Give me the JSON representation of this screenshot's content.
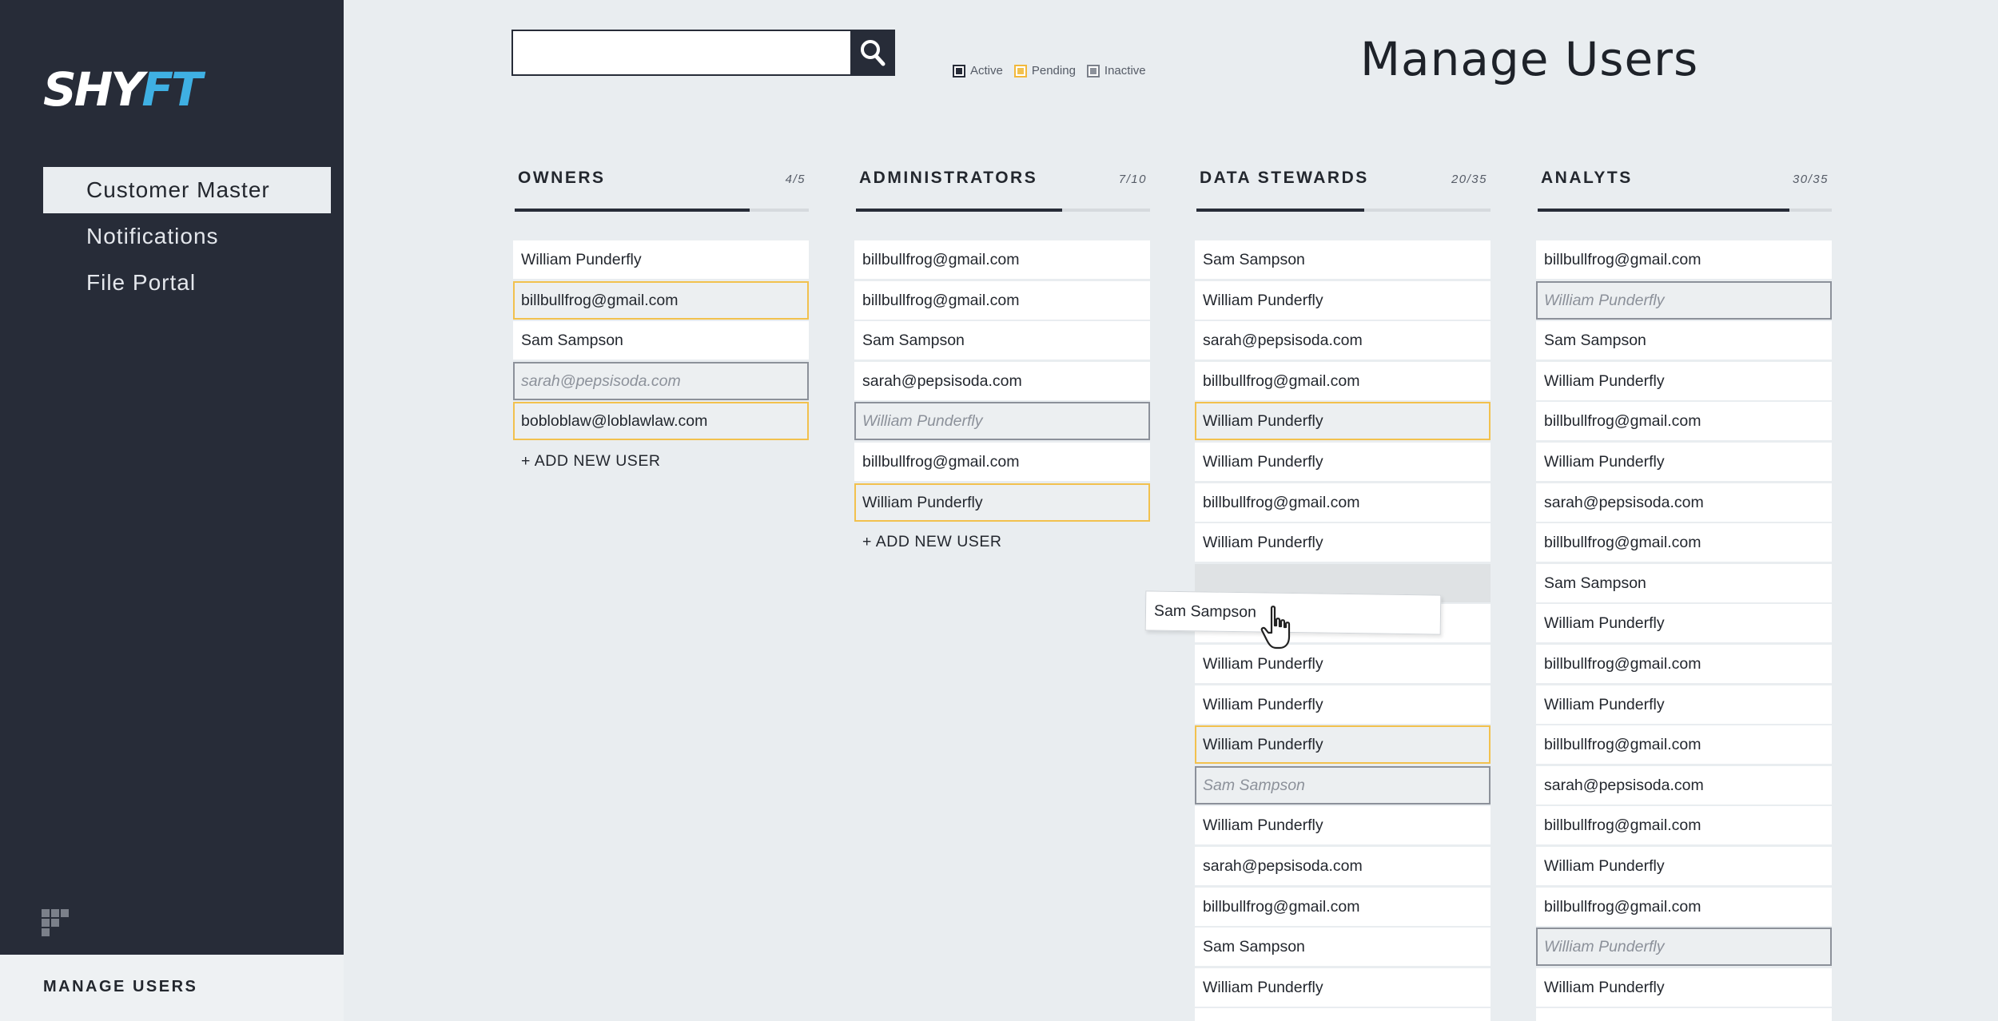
{
  "app": {
    "logo_part1": "SHY",
    "logo_part2": "FT",
    "brand_color": "#3fb0e3",
    "sidebar_bg": "#272c38"
  },
  "sidebar": {
    "items": [
      {
        "label": "Customer Master",
        "active": true
      },
      {
        "label": "Notifications",
        "active": false
      },
      {
        "label": "File Portal",
        "active": false
      }
    ],
    "footer_icon": "grid-icon",
    "bottom_title": "MANAGE USERS"
  },
  "search": {
    "value": "",
    "placeholder": "",
    "icon": "search-icon"
  },
  "legend": [
    {
      "label": "Active",
      "color": "#272c38"
    },
    {
      "label": "Pending",
      "color": "#f2c14e"
    },
    {
      "label": "Inactive",
      "color": "#8c919a"
    }
  ],
  "page_title": "Manage Users",
  "add_user_label": "+ ADD NEW USER",
  "columns": [
    {
      "title": "OWNERS",
      "count": "4/5",
      "fill": 0.8,
      "has_add": true,
      "rows": [
        {
          "text": "William Punderfly",
          "status": "active"
        },
        {
          "text": "billbullfrog@gmail.com",
          "status": "pending"
        },
        {
          "text": "Sam Sampson",
          "status": "active"
        },
        {
          "text": "sarah@pepsisoda.com",
          "status": "inactive"
        },
        {
          "text": "bobloblaw@loblawlaw.com",
          "status": "pending"
        }
      ]
    },
    {
      "title": "ADMINISTRATORS",
      "count": "7/10",
      "fill": 0.7,
      "has_add": true,
      "rows": [
        {
          "text": "billbullfrog@gmail.com",
          "status": "active"
        },
        {
          "text": "billbullfrog@gmail.com",
          "status": "active"
        },
        {
          "text": "Sam Sampson",
          "status": "active"
        },
        {
          "text": "sarah@pepsisoda.com",
          "status": "active"
        },
        {
          "text": "William Punderfly",
          "status": "inactive"
        },
        {
          "text": "billbullfrog@gmail.com",
          "status": "active"
        },
        {
          "text": "William Punderfly",
          "status": "pending"
        }
      ]
    },
    {
      "title": "DATA STEWARDS",
      "count": "20/35",
      "fill": 0.571,
      "has_add": false,
      "rows": [
        {
          "text": "Sam Sampson",
          "status": "active"
        },
        {
          "text": "William Punderfly",
          "status": "active"
        },
        {
          "text": "sarah@pepsisoda.com",
          "status": "active"
        },
        {
          "text": "billbullfrog@gmail.com",
          "status": "active"
        },
        {
          "text": "William Punderfly",
          "status": "pending"
        },
        {
          "text": "William Punderfly",
          "status": "active"
        },
        {
          "text": "billbullfrog@gmail.com",
          "status": "active"
        },
        {
          "text": "William Punderfly",
          "status": "active"
        },
        {
          "text": "",
          "status": "placeholder"
        },
        {
          "text": "",
          "status": "active"
        },
        {
          "text": "William Punderfly",
          "status": "active"
        },
        {
          "text": "William Punderfly",
          "status": "active"
        },
        {
          "text": "William Punderfly",
          "status": "pending"
        },
        {
          "text": "Sam Sampson",
          "status": "inactive"
        },
        {
          "text": "William Punderfly",
          "status": "active"
        },
        {
          "text": "sarah@pepsisoda.com",
          "status": "active"
        },
        {
          "text": "billbullfrog@gmail.com",
          "status": "active"
        },
        {
          "text": "Sam Sampson",
          "status": "active"
        },
        {
          "text": "William Punderfly",
          "status": "active"
        },
        {
          "text": "",
          "status": "active"
        }
      ]
    },
    {
      "title": "ANALYTS",
      "count": "30/35",
      "fill": 0.857,
      "has_add": false,
      "rows": [
        {
          "text": "billbullfrog@gmail.com",
          "status": "active"
        },
        {
          "text": "William Punderfly",
          "status": "inactive"
        },
        {
          "text": "Sam Sampson",
          "status": "active"
        },
        {
          "text": "William Punderfly",
          "status": "active"
        },
        {
          "text": "billbullfrog@gmail.com",
          "status": "active"
        },
        {
          "text": "William Punderfly",
          "status": "active"
        },
        {
          "text": "sarah@pepsisoda.com",
          "status": "active"
        },
        {
          "text": "billbullfrog@gmail.com",
          "status": "active"
        },
        {
          "text": "Sam Sampson",
          "status": "active"
        },
        {
          "text": "William Punderfly",
          "status": "active"
        },
        {
          "text": "billbullfrog@gmail.com",
          "status": "active"
        },
        {
          "text": "William Punderfly",
          "status": "active"
        },
        {
          "text": "billbullfrog@gmail.com",
          "status": "active"
        },
        {
          "text": "sarah@pepsisoda.com",
          "status": "active"
        },
        {
          "text": "billbullfrog@gmail.com",
          "status": "active"
        },
        {
          "text": "William Punderfly",
          "status": "active"
        },
        {
          "text": "billbullfrog@gmail.com",
          "status": "active"
        },
        {
          "text": "William Punderfly",
          "status": "inactive"
        },
        {
          "text": "William Punderfly",
          "status": "active"
        },
        {
          "text": "",
          "status": "active"
        }
      ]
    }
  ],
  "drag": {
    "text": "Sam Sampson",
    "cursor_icon": "hand-pointer-icon"
  }
}
